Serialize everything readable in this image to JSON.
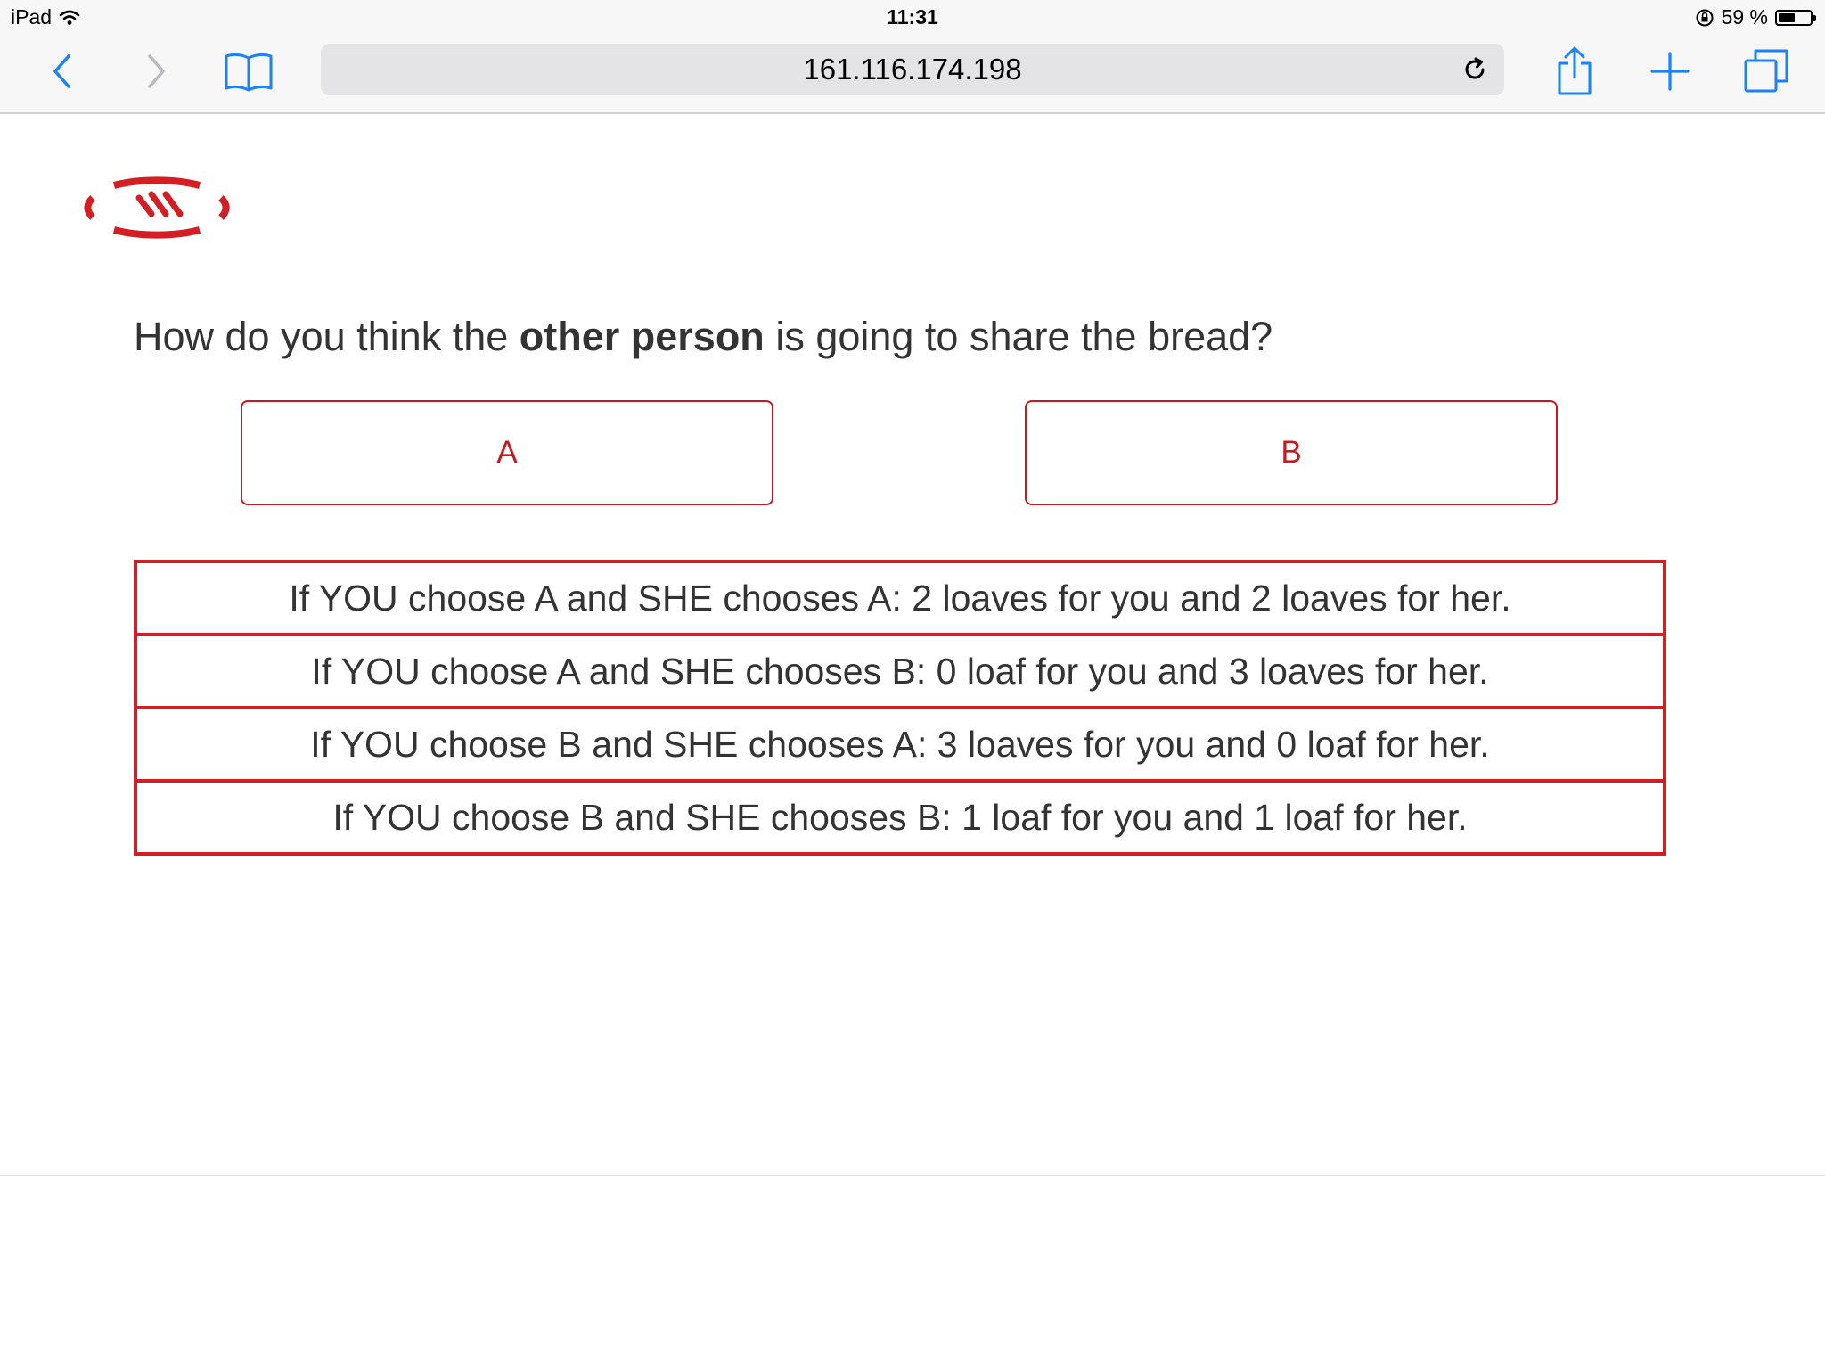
{
  "status_bar": {
    "device": "iPad",
    "time": "11:31",
    "battery": "59 %",
    "battery_level": 0.59
  },
  "browser": {
    "url": "161.116.174.198",
    "icons": [
      "back-icon",
      "forward-icon",
      "bookmarks-icon",
      "reload-icon",
      "share-icon",
      "new-tab-icon",
      "tabs-icon"
    ]
  },
  "colors": {
    "accent": "#d31f24",
    "ios_blue": "#1a82fb",
    "text": "#333333"
  },
  "question": {
    "prefix": "How do you think the ",
    "emphasis": "other person",
    "suffix": " is going to share the bread?"
  },
  "choices": [
    {
      "label": "A"
    },
    {
      "label": "B"
    }
  ],
  "payoffs": [
    "If YOU choose A and SHE chooses A: 2 loaves for you and 2 loaves for her.",
    "If YOU choose A and SHE chooses B: 0 loaf for you and 3 loaves for her.",
    "If YOU choose B and SHE chooses A: 3 loaves for you and 0 loaf for her.",
    "If YOU choose B and SHE chooses B: 1 loaf for you and 1 loaf for her."
  ]
}
